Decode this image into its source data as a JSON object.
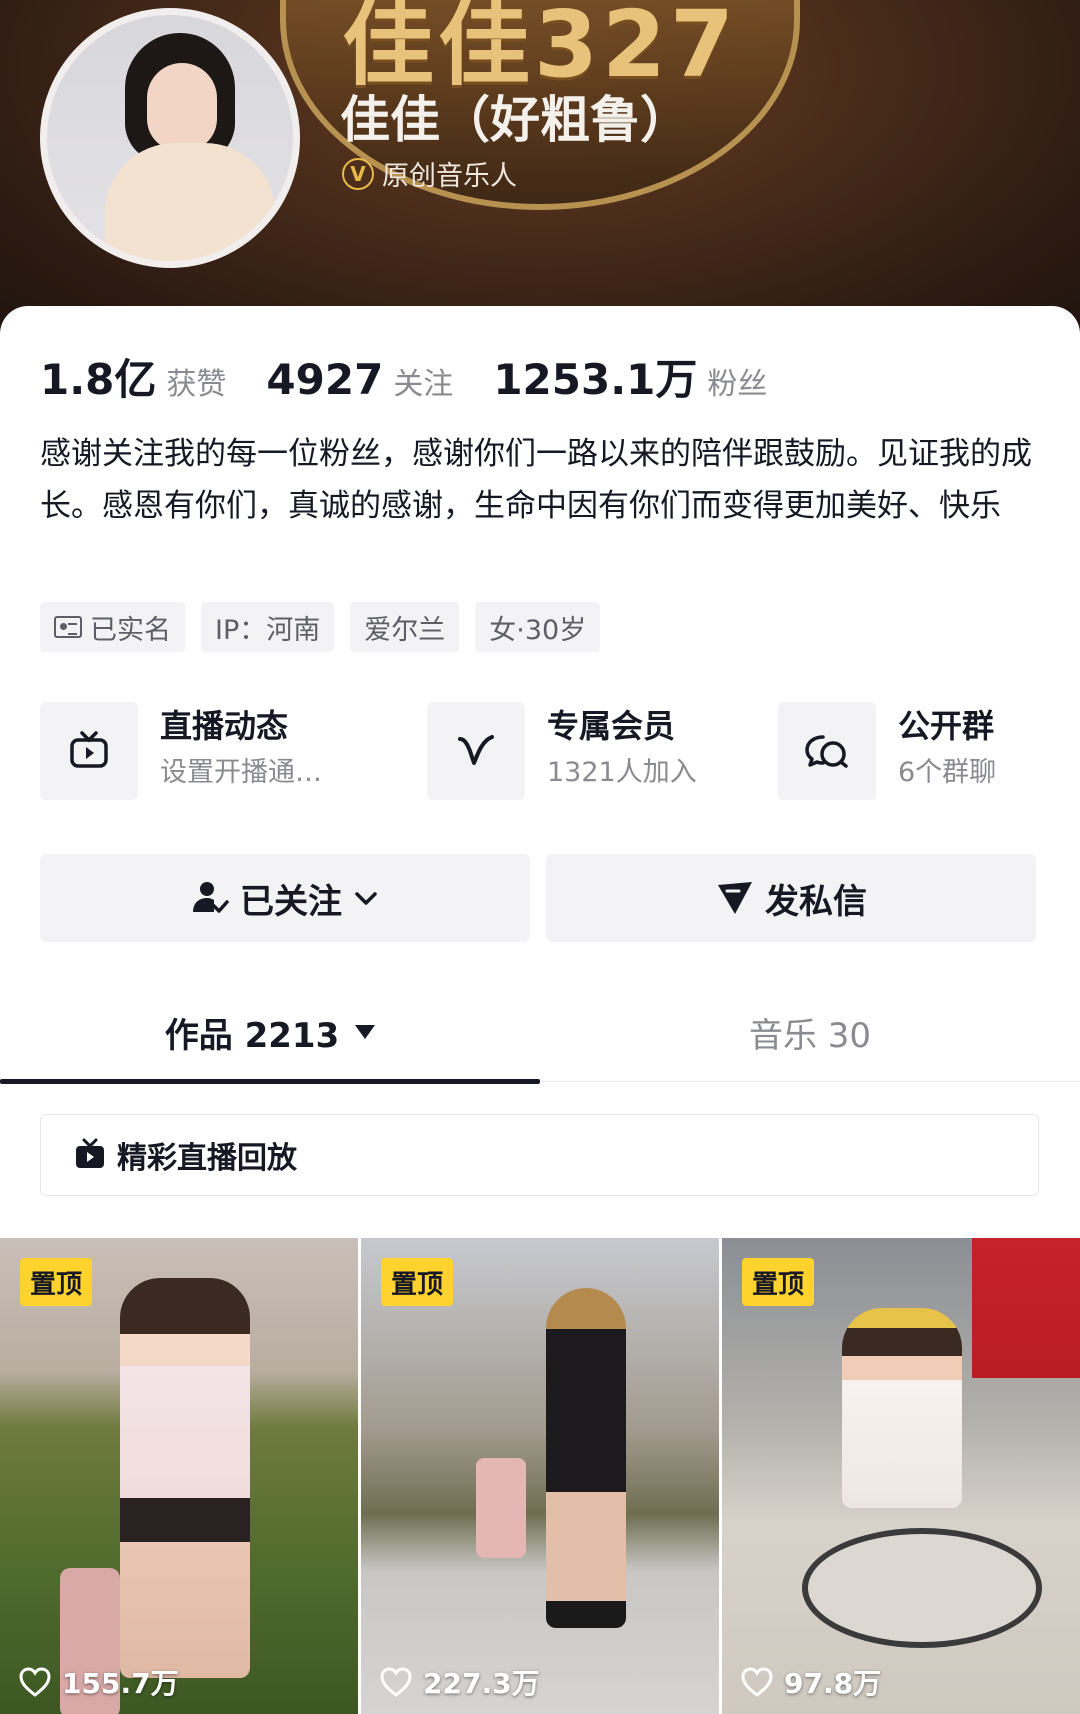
{
  "header": {
    "banner_text": "佳佳327",
    "name": "佳佳（好粗鲁）",
    "verified_badge": "V",
    "verified_label": "原创音乐人"
  },
  "stats": [
    {
      "value": "1.8亿",
      "label": "获赞"
    },
    {
      "value": "4927",
      "label": "关注"
    },
    {
      "value": "1253.1万",
      "label": "粉丝"
    }
  ],
  "bio": "感谢关注我的每一位粉丝，感谢你们一路以来的陪伴跟鼓励。见证我的成长。感恩有你们，真诚的感谢，生命中因有你们而变得更加美好、快乐",
  "tags": [
    "已实名",
    "IP：河南",
    "爱尔兰",
    "女·30岁"
  ],
  "features": [
    {
      "title": "直播动态",
      "subtitle": "设置开播通…",
      "icon": "tv-icon"
    },
    {
      "title": "专属会员",
      "subtitle": "1321人加入",
      "icon": "v-member-icon"
    },
    {
      "title": "公开群",
      "subtitle": "6个群聊",
      "icon": "group-chat-icon"
    }
  ],
  "buttons": {
    "follow": "已关注",
    "message": "发私信"
  },
  "tabs": {
    "works": "作品 2213",
    "music": "音乐 30"
  },
  "replay_label": "精彩直播回放",
  "videos": [
    {
      "pin": "置顶",
      "likes": "155.7万"
    },
    {
      "pin": "置顶",
      "likes": "227.3万"
    },
    {
      "pin": "置顶",
      "likes": "97.8万"
    }
  ],
  "colors": {
    "pin_badge": "#ffd32e",
    "header_brown": "#3b2615",
    "verify_gold": "#e7b94a"
  }
}
